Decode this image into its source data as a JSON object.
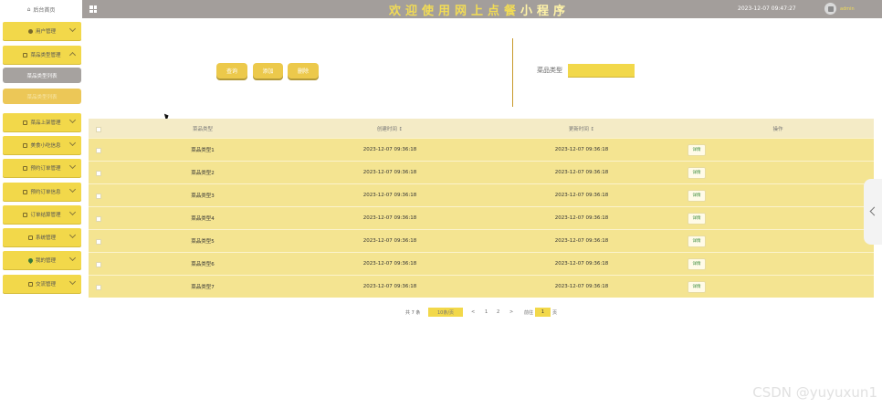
{
  "header": {
    "home_label": "后台首页",
    "title_main": "欢迎使用网上点餐",
    "title_accent": "小程序",
    "datetime": "2023-12-07 09:47:27",
    "username": "admin"
  },
  "sidebar": {
    "items": [
      {
        "label": "用户管理",
        "icon": "person-icon"
      },
      {
        "label": "菜品类型管理",
        "icon": "doc-icon"
      },
      {
        "label": "菜品上架管理",
        "icon": "doc-icon"
      },
      {
        "label": "美食小吃信息",
        "icon": "doc-icon"
      },
      {
        "label": "预约订单管理",
        "icon": "doc-icon"
      },
      {
        "label": "预约订单信息",
        "icon": "doc-icon"
      },
      {
        "label": "订单结算管理",
        "icon": "doc-icon"
      },
      {
        "label": "系统管理",
        "icon": "grid-icon"
      },
      {
        "label": "我的管理",
        "icon": "pin-icon"
      },
      {
        "label": "交流管理",
        "icon": "chat-icon"
      }
    ],
    "sub_active": "菜品类型列表",
    "sub_muted": "菜品类型列表"
  },
  "toolbar": {
    "query": "查询",
    "add": "添加",
    "delete": "删除"
  },
  "filter": {
    "label": "菜品类型",
    "value": ""
  },
  "table": {
    "headers": [
      "菜品类型",
      "创建时间 ↕",
      "更新时间 ↕",
      "操作"
    ],
    "detail_label": "详情",
    "rows": [
      {
        "name": "菜品类型1",
        "created": "2023-12-07 09:36:18",
        "updated": "2023-12-07 09:36:18"
      },
      {
        "name": "菜品类型2",
        "created": "2023-12-07 09:36:18",
        "updated": "2023-12-07 09:36:18"
      },
      {
        "name": "菜品类型3",
        "created": "2023-12-07 09:36:18",
        "updated": "2023-12-07 09:36:18"
      },
      {
        "name": "菜品类型4",
        "created": "2023-12-07 09:36:18",
        "updated": "2023-12-07 09:36:18"
      },
      {
        "name": "菜品类型5",
        "created": "2023-12-07 09:36:18",
        "updated": "2023-12-07 09:36:18"
      },
      {
        "name": "菜品类型6",
        "created": "2023-12-07 09:36:18",
        "updated": "2023-12-07 09:36:18"
      },
      {
        "name": "菜品类型7",
        "created": "2023-12-07 09:36:18",
        "updated": "2023-12-07 09:36:18"
      }
    ]
  },
  "pager": {
    "total": "共 7 条",
    "page_size": "10条/页",
    "prev": "<",
    "page1": "1",
    "page2": "2",
    "next": ">",
    "goto": "前往",
    "current": "1",
    "suffix": "页"
  },
  "watermark": "CSDN @yuyuxun1",
  "colors": {
    "header_bg": "#a39e9b",
    "accent": "#f2d84a",
    "row_bg": "#f4e491"
  }
}
